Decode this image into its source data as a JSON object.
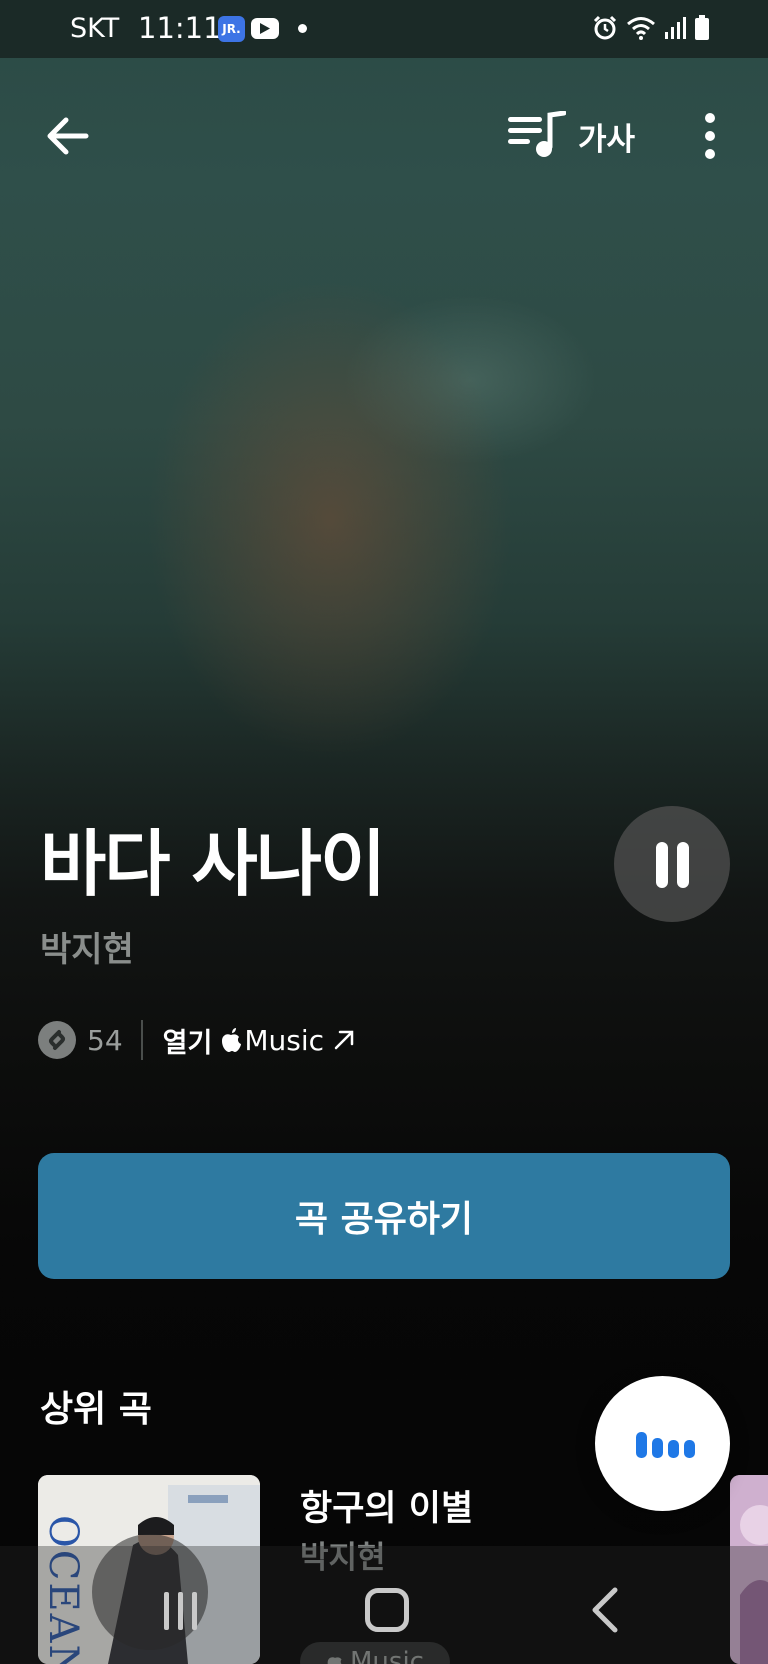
{
  "status_bar": {
    "carrier": "SKT",
    "time": "11:11",
    "app_badge_text": "JR."
  },
  "toolbar": {
    "lyrics_label": "가사"
  },
  "track": {
    "title": "바다 사나이",
    "artist": "박지현",
    "shazam_count": "54",
    "open_label": "열기",
    "service_label": "Music"
  },
  "share": {
    "label": "곡 공유하기"
  },
  "top_songs": {
    "section_title": "상위 곡",
    "items": [
      {
        "title": "항구의 이별",
        "artist": "박지현",
        "album_text": "OCEAN",
        "service_label": "Music"
      }
    ]
  },
  "colors": {
    "share_button": "#2e7aa1",
    "listen_wave": "#1f78e6",
    "app_badge": "#3d74e5"
  },
  "icons": {
    "back": "arrow-left-icon",
    "lyrics": "lyrics-note-icon",
    "more": "more-vertical-icon",
    "pause": "pause-icon",
    "shazam": "shazam-icon",
    "apple": "apple-icon",
    "external": "arrow-up-right-icon",
    "listen": "listen-wave-icon"
  }
}
